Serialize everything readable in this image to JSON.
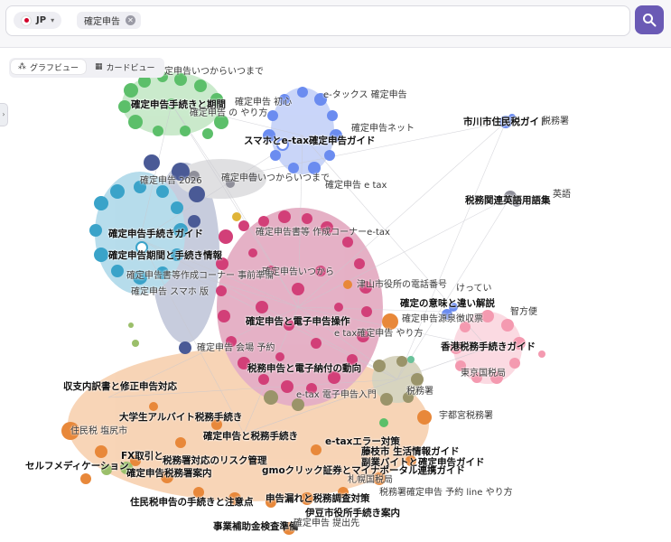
{
  "search": {
    "region_label": "JP",
    "query_tag": "確定申告",
    "region_flag_icon": "japan-flag-icon",
    "search_icon": "search-icon"
  },
  "view_toggle": {
    "graph_label": "グラフビュー",
    "card_label": "カードビュー",
    "active": "graph"
  },
  "colors": {
    "accent": "#6a5ab5",
    "green": "#5cbf6a",
    "blue": "#6b8cf0",
    "teal": "#3aa3c9",
    "pink": "#d65a8a",
    "orange": "#f0a060",
    "salmon": "#f49ab0",
    "gray": "#8f8f9a"
  },
  "graph": {
    "labels": [
      {
        "text": "確定申告いつからいつまで",
        "bold": false
      },
      {
        "text": "確定申告手続きと期間",
        "bold": true
      },
      {
        "text": "確定申告 の やり方",
        "bold": false
      },
      {
        "text": "確定申告 初心",
        "bold": false
      },
      {
        "text": "e-タックス 確定申告",
        "bold": false
      },
      {
        "text": "確定申告ネット",
        "bold": false
      },
      {
        "text": "スマホとe-tax確定申告ガイド",
        "bold": true
      },
      {
        "text": "市川市住民税ガイド",
        "bold": true
      },
      {
        "text": "税務署",
        "bold": false
      },
      {
        "text": "確定申告いつからいつまで",
        "bold": false
      },
      {
        "text": "確定申告 e tax",
        "bold": false
      },
      {
        "text": "確定申告 2026",
        "bold": false
      },
      {
        "text": "税務関連英語用語集",
        "bold": true
      },
      {
        "text": "英語",
        "bold": false
      },
      {
        "text": "確定申告手続きガイド",
        "bold": true
      },
      {
        "text": "確定申告書等 作成コーナーe-tax",
        "bold": false
      },
      {
        "text": "確定申告期間と手続き情報",
        "bold": true
      },
      {
        "text": "確定申告書等作成コーナー 事前準備",
        "bold": false
      },
      {
        "text": "確定申告いつから",
        "bold": false
      },
      {
        "text": "確定申告 スマホ 版",
        "bold": false
      },
      {
        "text": "津山市役所の電話番号",
        "bold": false
      },
      {
        "text": "けってい",
        "bold": false
      },
      {
        "text": "確定の意味と違い解説",
        "bold": true
      },
      {
        "text": "智方便",
        "bold": false
      },
      {
        "text": "確定申告と電子申告操作",
        "bold": true
      },
      {
        "text": "確定申告源泉徴収票",
        "bold": false
      },
      {
        "text": "e tax確定申告 やり方",
        "bold": false
      },
      {
        "text": "香港税務手続きガイド",
        "bold": true
      },
      {
        "text": "確定申告 会場 予約",
        "bold": false
      },
      {
        "text": "税務申告と電子納付の動向",
        "bold": true
      },
      {
        "text": "東京国税局",
        "bold": false
      },
      {
        "text": "収支内訳書と修正申告対応",
        "bold": true
      },
      {
        "text": "e-tax 電子申告入門",
        "bold": false
      },
      {
        "text": "税務署",
        "bold": false
      },
      {
        "text": "大学生アルバイト税務手続き",
        "bold": true
      },
      {
        "text": "宇都宮税務署",
        "bold": false
      },
      {
        "text": "住民税 塩尻市",
        "bold": false
      },
      {
        "text": "確定申告と税務手続き",
        "bold": true
      },
      {
        "text": "e-taxエラー対策",
        "bold": true
      },
      {
        "text": "藤枝市 生活情報ガイド",
        "bold": true
      },
      {
        "text": "FX取引と",
        "bold": true
      },
      {
        "text": "税務署対応のリスク管理",
        "bold": true
      },
      {
        "text": "副業バイトと確定申告ガイド",
        "bold": true
      },
      {
        "text": "セルフメディケーション",
        "bold": true
      },
      {
        "text": "確定申告税務署案内",
        "bold": true
      },
      {
        "text": "gmoクリック証券とマイナポータル連携ガイド",
        "bold": true
      },
      {
        "text": "札幌国税局",
        "bold": false
      },
      {
        "text": "住民税申告の手続きと注意点",
        "bold": true
      },
      {
        "text": "申告漏れと税務調査対策",
        "bold": true
      },
      {
        "text": "税務署確定申告 予約 line やり方",
        "bold": false
      },
      {
        "text": "伊豆市役所手続き案内",
        "bold": true
      },
      {
        "text": "事業補助金検査準備",
        "bold": true
      },
      {
        "text": "確定申告 提出先",
        "bold": false
      }
    ]
  }
}
